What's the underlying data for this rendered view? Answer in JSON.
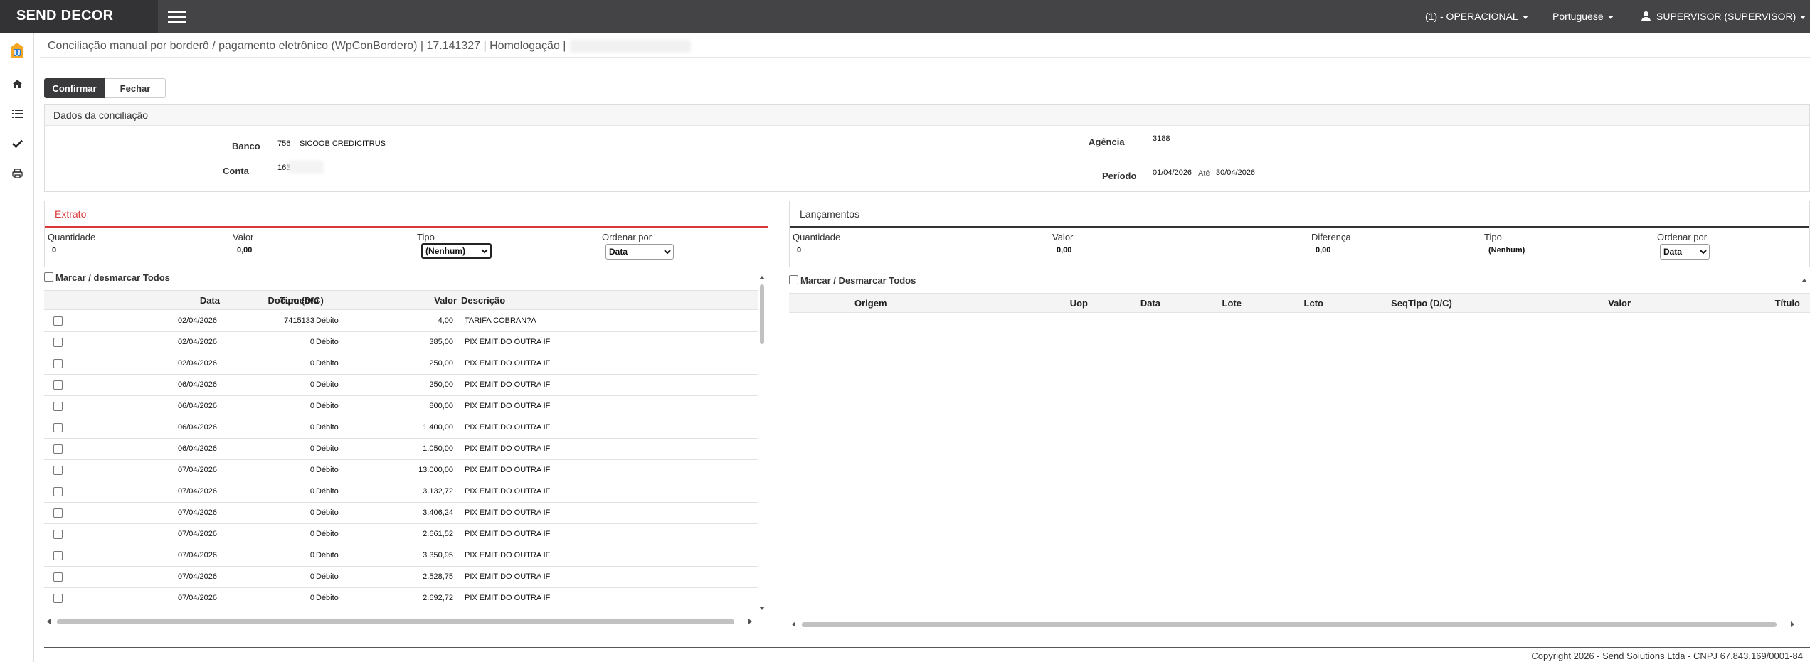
{
  "app": {
    "brand": "SEND DECOR",
    "menu_operacional": "(1) - OPERACIONAL",
    "menu_language": "Portuguese",
    "menu_user": "SUPERVISOR (SUPERVISOR)"
  },
  "page": {
    "title": "Conciliação manual por borderô / pagamento eletrônico (WpConBordero) | 17.141327 | Homologação |"
  },
  "toolbar": {
    "confirm_label": "Confirmar",
    "close_label": "Fechar"
  },
  "dados": {
    "header": "Dados da conciliação",
    "banco_label": "Banco",
    "banco_codigo": "756",
    "banco_nome": "SICOOB CREDICITRUS",
    "conta_label": "Conta",
    "conta_valor": "163",
    "agencia_label": "Agência",
    "agencia_valor": "3188",
    "periodo_label": "Período",
    "periodo_inicio": "01/04/2026",
    "periodo_ate_label": "Até",
    "periodo_fim": "30/04/2026"
  },
  "extrato": {
    "header": "Extrato",
    "quantidade_label": "Quantidade",
    "quantidade_valor": "0",
    "valor_label": "Valor",
    "valor_valor": "0,00",
    "tipo_label": "Tipo",
    "tipo_selected": "(Nenhum)",
    "ordenar_label": "Ordenar por",
    "ordenar_selected": "Data",
    "marcar_label": "Marcar / desmarcar Todos",
    "columns": {
      "data": "Data",
      "documento": "Documento",
      "tipo": "Tipo (D/C)",
      "valor": "Valor",
      "descricao": "Descrição"
    },
    "rows": [
      {
        "data": "02/04/2026",
        "documento": "7415133",
        "tipo": "Débito",
        "valor": "4,00",
        "descricao": "TARIFA COBRAN?A"
      },
      {
        "data": "02/04/2026",
        "documento": "0",
        "tipo": "Débito",
        "valor": "385,00",
        "descricao": "PIX EMITIDO OUTRA IF"
      },
      {
        "data": "02/04/2026",
        "documento": "0",
        "tipo": "Débito",
        "valor": "250,00",
        "descricao": "PIX EMITIDO OUTRA IF"
      },
      {
        "data": "06/04/2026",
        "documento": "0",
        "tipo": "Débito",
        "valor": "250,00",
        "descricao": "PIX EMITIDO OUTRA IF"
      },
      {
        "data": "06/04/2026",
        "documento": "0",
        "tipo": "Débito",
        "valor": "800,00",
        "descricao": "PIX EMITIDO OUTRA IF"
      },
      {
        "data": "06/04/2026",
        "documento": "0",
        "tipo": "Débito",
        "valor": "1.400,00",
        "descricao": "PIX EMITIDO OUTRA IF"
      },
      {
        "data": "06/04/2026",
        "documento": "0",
        "tipo": "Débito",
        "valor": "1.050,00",
        "descricao": "PIX EMITIDO OUTRA IF"
      },
      {
        "data": "07/04/2026",
        "documento": "0",
        "tipo": "Débito",
        "valor": "13.000,00",
        "descricao": "PIX EMITIDO OUTRA IF"
      },
      {
        "data": "07/04/2026",
        "documento": "0",
        "tipo": "Débito",
        "valor": "3.132,72",
        "descricao": "PIX EMITIDO OUTRA IF"
      },
      {
        "data": "07/04/2026",
        "documento": "0",
        "tipo": "Débito",
        "valor": "3.406,24",
        "descricao": "PIX EMITIDO OUTRA IF"
      },
      {
        "data": "07/04/2026",
        "documento": "0",
        "tipo": "Débito",
        "valor": "2.661,52",
        "descricao": "PIX EMITIDO OUTRA IF"
      },
      {
        "data": "07/04/2026",
        "documento": "0",
        "tipo": "Débito",
        "valor": "3.350,95",
        "descricao": "PIX EMITIDO OUTRA IF"
      },
      {
        "data": "07/04/2026",
        "documento": "0",
        "tipo": "Débito",
        "valor": "2.528,75",
        "descricao": "PIX EMITIDO OUTRA IF"
      },
      {
        "data": "07/04/2026",
        "documento": "0",
        "tipo": "Débito",
        "valor": "2.692,72",
        "descricao": "PIX EMITIDO OUTRA IF"
      }
    ]
  },
  "lancamentos": {
    "header": "Lançamentos",
    "quantidade_label": "Quantidade",
    "quantidade_valor": "0",
    "valor_label": "Valor",
    "valor_valor": "0,00",
    "diferenca_label": "Diferença",
    "diferenca_valor": "0,00",
    "tipo_label": "Tipo",
    "tipo_valor": "(Nenhum)",
    "ordenar_label": "Ordenar por",
    "ordenar_selected": "Data",
    "marcar_label": "Marcar / Desmarcar Todos",
    "columns": {
      "origem": "Origem",
      "uop": "Uop",
      "data": "Data",
      "lote": "Lote",
      "lcto": "Lcto",
      "seq": "Seq",
      "tipo": "Tipo (D/C)",
      "valor": "Valor",
      "titulo": "Título"
    }
  },
  "footer": {
    "copyright": "Copyright 2026 - Send Solutions Ltda - CNPJ 67.843.169/0001-84"
  }
}
